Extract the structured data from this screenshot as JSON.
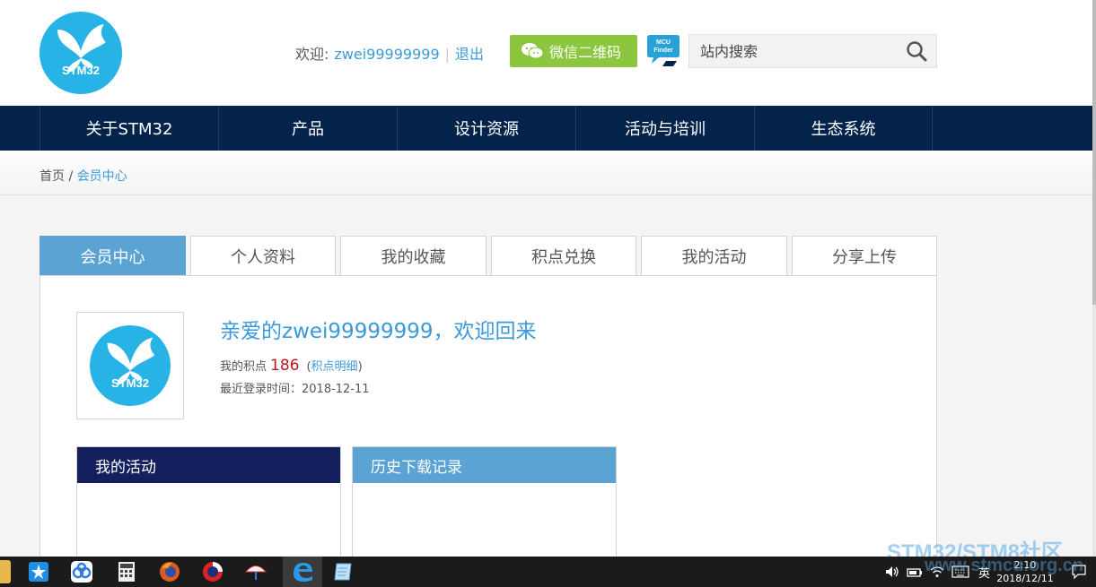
{
  "header": {
    "logo_text": "STM32",
    "welcome_label": "欢迎:",
    "username": "zwei99999999",
    "logout_label": "退出",
    "wechat_label": "微信二维码",
    "mcu_finder_label_1": "MCU",
    "mcu_finder_label_2": "Finder",
    "search_placeholder": "站内搜索"
  },
  "nav": {
    "items": [
      {
        "label": "关于STM32"
      },
      {
        "label": "产品"
      },
      {
        "label": "设计资源"
      },
      {
        "label": "活动与培训"
      },
      {
        "label": "生态系统"
      }
    ]
  },
  "breadcrumb": {
    "home": "首页",
    "separator": "/",
    "current": "会员中心"
  },
  "tabs": [
    {
      "label": "会员中心",
      "active": true
    },
    {
      "label": "个人资料"
    },
    {
      "label": "我的收藏"
    },
    {
      "label": "积点兑换"
    },
    {
      "label": "我的活动"
    },
    {
      "label": "分享上传"
    }
  ],
  "profile": {
    "avatar_text": "STM32",
    "greeting": "亲爱的zwei99999999，欢迎回来",
    "points_label": "我的积点",
    "points_value": "186",
    "points_detail_open": "(",
    "points_detail_link": "积点明细",
    "points_detail_close": ")",
    "last_login_label": "最近登录时间：",
    "last_login_value": "2018-12-11"
  },
  "panels": {
    "my_activities": "我的活动",
    "download_history": "历史下载记录"
  },
  "taskbar": {
    "ime": "英",
    "time": "2:10",
    "date": "2018/12/11"
  },
  "watermark": {
    "line1": "STM32/STM8社区",
    "line2": "www.stmcu.org.cn"
  },
  "colors": {
    "brand_blue": "#28b3e6",
    "nav_bg": "#03234b",
    "accent_tab": "#5aa3d3",
    "wechat_green": "#8cc63f",
    "points_red": "#c0161c",
    "link_blue": "#3a9ad9"
  }
}
